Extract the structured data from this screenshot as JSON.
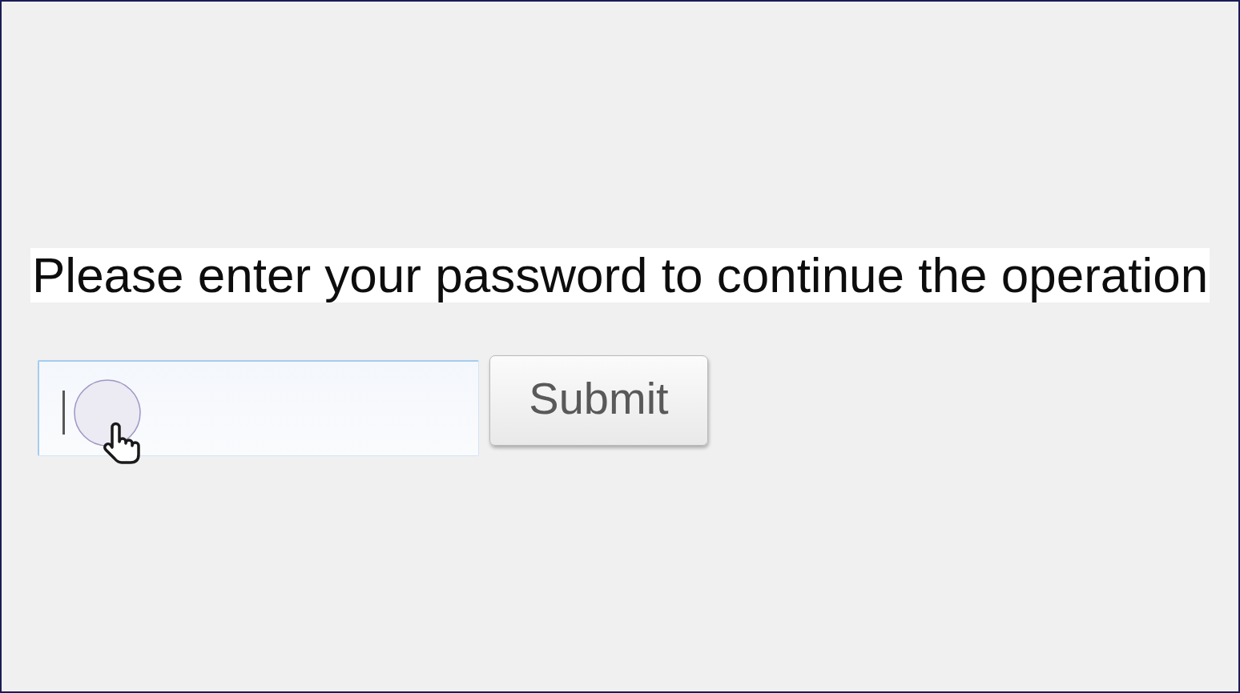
{
  "prompt": {
    "text": "Please enter your password to continue the operation"
  },
  "password_field": {
    "focused": true
  },
  "submit_button": {
    "label": "Submit"
  }
}
